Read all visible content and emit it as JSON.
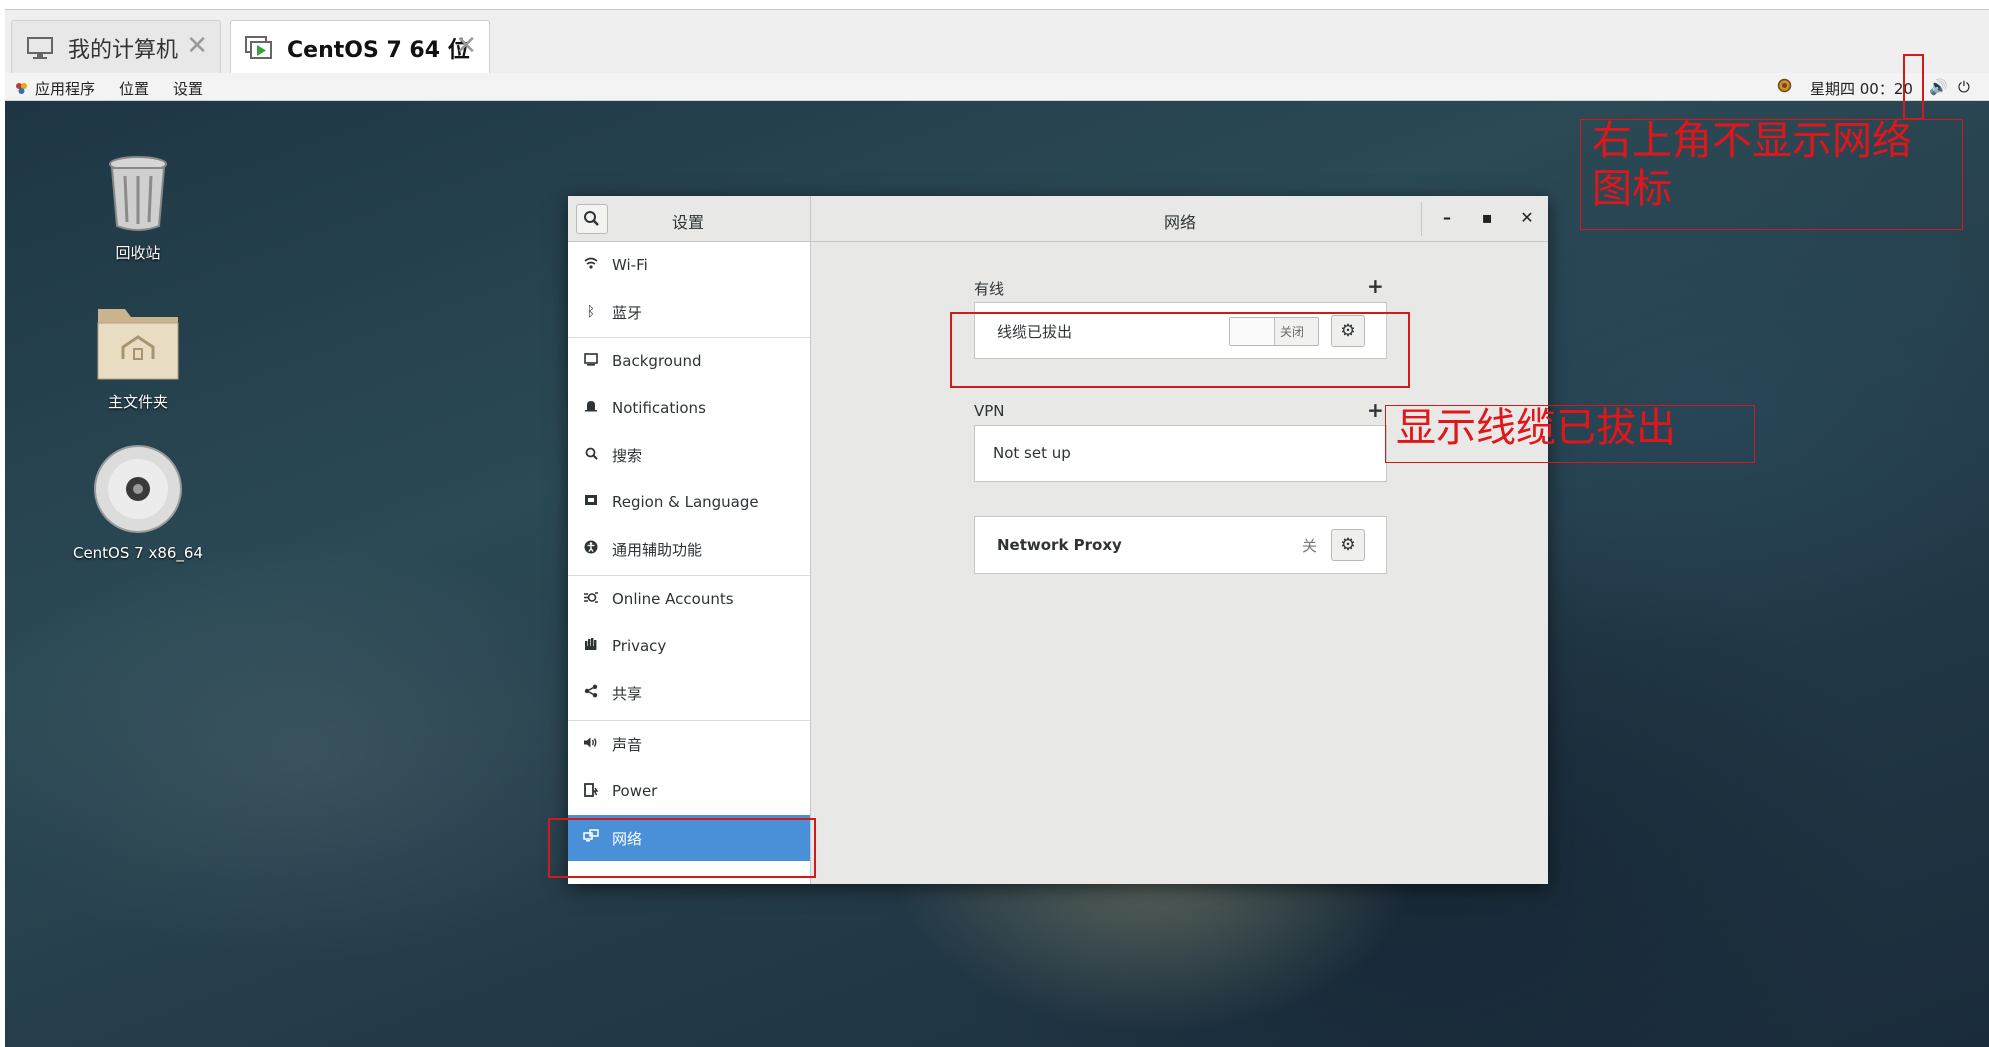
{
  "vm_tabs": [
    {
      "label": "我的计算机"
    },
    {
      "label": "CentOS 7 64 位"
    }
  ],
  "topbar": {
    "apps_label": "应用程序",
    "places_label": "位置",
    "settings_label": "设置",
    "clock": "星期四 00：20"
  },
  "desktop_icons": [
    {
      "label": "回收站"
    },
    {
      "label": "主文件夹"
    },
    {
      "label": "CentOS 7 x86_64"
    }
  ],
  "settings_window": {
    "left_title": "设置",
    "title": "网络",
    "sidebar": [
      {
        "label": "Wi-Fi",
        "icon": "wifi-icon"
      },
      {
        "label": "蓝牙",
        "icon": "bluetooth-icon"
      },
      {
        "label": "Background",
        "icon": "background-icon"
      },
      {
        "label": "Notifications",
        "icon": "bell-icon"
      },
      {
        "label": "搜索",
        "icon": "search-icon"
      },
      {
        "label": "Region & Language",
        "icon": "flag-icon"
      },
      {
        "label": "通用辅助功能",
        "icon": "accessibility-icon"
      },
      {
        "label": "Online Accounts",
        "icon": "online-accounts-icon"
      },
      {
        "label": "Privacy",
        "icon": "hand-icon"
      },
      {
        "label": "共享",
        "icon": "share-icon"
      },
      {
        "label": "声音",
        "icon": "speaker-icon"
      },
      {
        "label": "Power",
        "icon": "power-icon"
      },
      {
        "label": "网络",
        "icon": "network-icon",
        "selected": true
      }
    ],
    "wired": {
      "section_title": "有线",
      "status": "线缆已拔出",
      "toggle_label": "关闭"
    },
    "vpn": {
      "section_title": "VPN",
      "status": "Not set up"
    },
    "proxy": {
      "label": "Network Proxy",
      "state": "关"
    }
  },
  "annotations": {
    "top_right": "右上角不显示网络\n图标",
    "cable": "显示线缆已拔出",
    "color": "#e0161a"
  }
}
